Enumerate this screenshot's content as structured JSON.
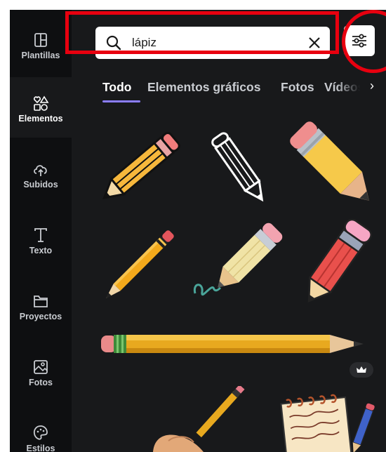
{
  "sidebar": {
    "items": [
      {
        "label": "Plantillas",
        "icon": "templates-icon"
      },
      {
        "label": "Elementos",
        "icon": "elements-icon",
        "active": true
      },
      {
        "label": "Subidos",
        "icon": "upload-cloud-icon"
      },
      {
        "label": "Texto",
        "icon": "text-icon"
      },
      {
        "label": "Proyectos",
        "icon": "folder-icon"
      },
      {
        "label": "Fotos",
        "icon": "photo-icon"
      },
      {
        "label": "Estilos",
        "icon": "palette-icon"
      }
    ]
  },
  "search": {
    "value": "lápiz",
    "icon": "search-icon",
    "clear_icon": "close-icon",
    "filter_icon": "filter-sliders-icon"
  },
  "tabs": [
    {
      "label": "Todo",
      "active": true
    },
    {
      "label": "Elementos gráficos"
    },
    {
      "label": "Fotos"
    },
    {
      "label": "Vídeos"
    }
  ],
  "results": [
    {
      "name": "pencil-orange-angled"
    },
    {
      "name": "pencil-outline-white"
    },
    {
      "name": "pencil-yellow-cartoon"
    },
    {
      "name": "pencil-thin-yellow"
    },
    {
      "name": "pencil-writing-scribble"
    },
    {
      "name": "pencil-red-cartoon"
    },
    {
      "name": "pencil-long-horizontal",
      "premium": true
    },
    {
      "name": "hand-holding-pencil"
    },
    {
      "name": "notepad-with-pencil"
    }
  ],
  "colors": {
    "highlight": "#e8000f",
    "tab_accent": "#8b7dff",
    "panel_bg": "#18191b",
    "sidebar_bg": "#0e0f11"
  }
}
